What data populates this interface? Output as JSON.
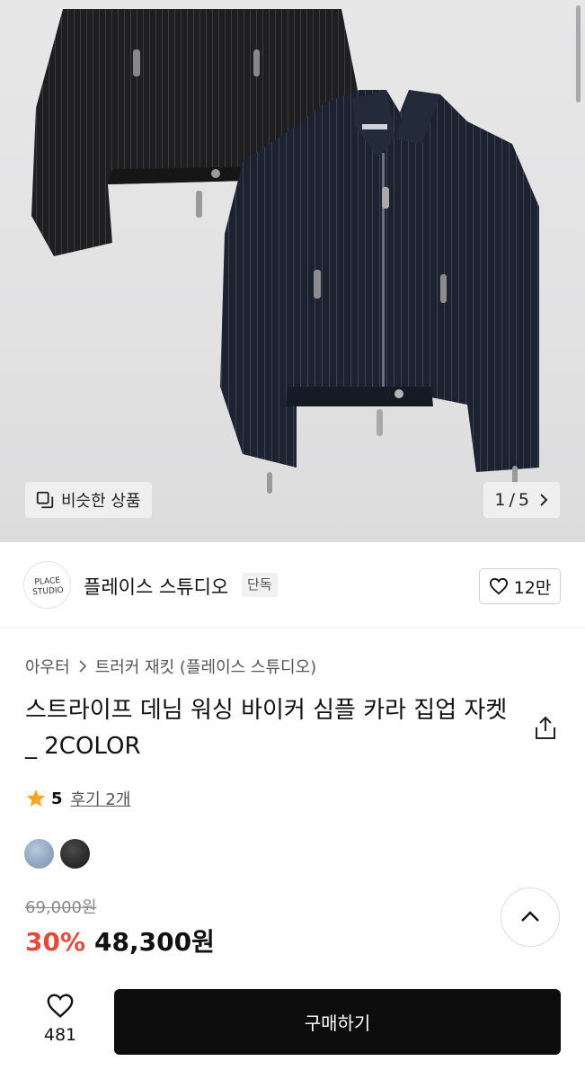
{
  "gallery": {
    "similar_label": "비슷한 상품",
    "current_page": "1",
    "page_separator": "/",
    "total_pages": "5"
  },
  "brand": {
    "logo_text_line1": "PLACE",
    "logo_text_line2": "STUDIO",
    "name": "플레이스 스튜디오",
    "tag": "단독",
    "like_count": "12만"
  },
  "product": {
    "breadcrumb": [
      "아우터",
      "트러커 재킷 (플레이스 스튜디오)"
    ],
    "title": "스트라이프 데님 워싱 바이커 심플 카라 집업 자켓 _ 2COLOR",
    "rating": "5",
    "reviews": "후기 2개",
    "colors": [
      "#9aafc8",
      "#2b2b2b"
    ],
    "original_price": "69,000원",
    "discount": "30%",
    "price": "48,300원"
  },
  "bottom_bar": {
    "wish_count": "481",
    "buy_label": "구매하기"
  },
  "icons": {
    "similar": "similar-items-icon",
    "pager_next": "chevron-right-icon",
    "like": "heart-outline-icon",
    "breadcrumb_sep": "chevron-right-icon",
    "share": "share-icon",
    "star": "star-icon",
    "scroll_top": "chevron-up-icon"
  },
  "colors": {
    "discount_red": "#e24b3b",
    "star_orange": "#f5a623",
    "buy_button": "#0d0d0d"
  }
}
